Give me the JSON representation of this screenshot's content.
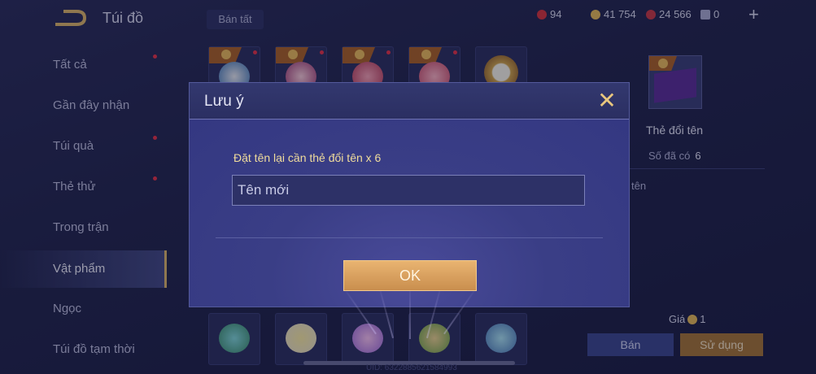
{
  "header": {
    "title": "Túi đồ",
    "sell_all": "Bán tất",
    "currencies": [
      {
        "icon": "ruby-icon",
        "value": "94",
        "color": "#d2353f"
      },
      {
        "icon": "gold-coin-icon",
        "value": "41 754",
        "color": "#e0b75a"
      },
      {
        "icon": "red-gem-icon",
        "value": "24 566",
        "color": "#c43a48"
      },
      {
        "icon": "ticket-icon",
        "value": "0",
        "color": "#a7aad0"
      }
    ],
    "plus": "+"
  },
  "sidebar": {
    "items": [
      {
        "label": "Tất cả",
        "dot": true
      },
      {
        "label": "Gần đây nhận",
        "dot": false
      },
      {
        "label": "Túi quà",
        "dot": true
      },
      {
        "label": "Thẻ thử",
        "dot": true
      },
      {
        "label": "Trong trận",
        "dot": false
      },
      {
        "label": "Vật phẩm",
        "dot": false,
        "active": true
      },
      {
        "label": "Ngọc",
        "dot": false
      },
      {
        "label": "Túi đồ tạm thời",
        "dot": false
      }
    ]
  },
  "detail": {
    "name": "Thẻ đổi tên",
    "owned_label": "Số đã có",
    "owned_value": "6",
    "desc": "tên",
    "price_label": "Giá",
    "price_value": "1",
    "sell": "Bán",
    "use": "Sử dụng"
  },
  "uid": "UID: 6322885621584993",
  "modal": {
    "title": "Lưu ý",
    "close": "✕",
    "message": "Đặt tên lại cần thẻ đổi tên x 6",
    "input_placeholder": "Tên mới",
    "ok": "OK"
  }
}
